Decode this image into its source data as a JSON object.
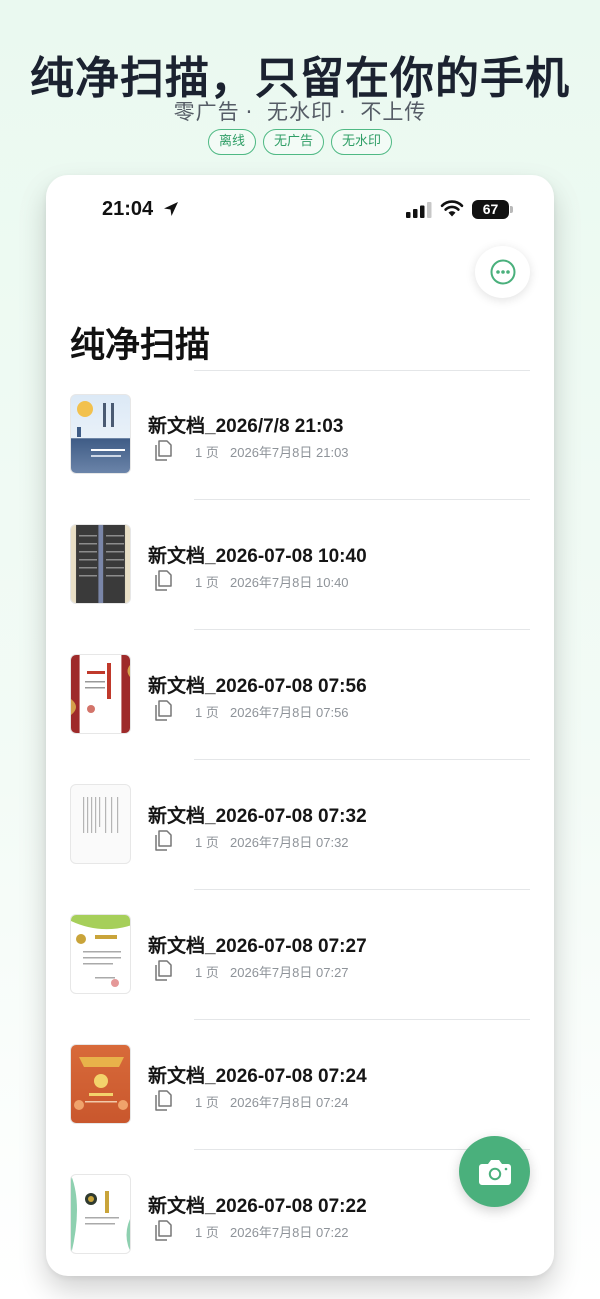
{
  "promo": {
    "title": "纯净扫描，只留在你的手机",
    "subtitle": [
      "零广告",
      "无水印",
      "不上传"
    ],
    "tags": [
      "离线",
      "无广告",
      "无水印"
    ]
  },
  "status_bar": {
    "time": "21:04",
    "battery": "67"
  },
  "header": {
    "title": "纯净扫描",
    "more_icon": "ellipsis-circle-icon"
  },
  "documents": [
    {
      "name": "新文档_2026/7/8 21:03",
      "pages": "1 页",
      "date": "2026年7月8日 21:03"
    },
    {
      "name": "新文档_2026-07-08 10:40",
      "pages": "1 页",
      "date": "2026年7月8日 10:40"
    },
    {
      "name": "新文档_2026-07-08 07:56",
      "pages": "1 页",
      "date": "2026年7月8日 07:56"
    },
    {
      "name": "新文档_2026-07-08 07:32",
      "pages": "1 页",
      "date": "2026年7月8日 07:32"
    },
    {
      "name": "新文档_2026-07-08 07:27",
      "pages": "1 页",
      "date": "2026年7月8日 07:27"
    },
    {
      "name": "新文档_2026-07-08 07:24",
      "pages": "1 页",
      "date": "2026年7月8日 07:24"
    },
    {
      "name": "新文档_2026-07-08 07:22",
      "pages": "1 页",
      "date": "2026年7月8日 07:22"
    }
  ],
  "fab": {
    "icon": "camera-icon"
  },
  "colors": {
    "accent": "#4ab07c",
    "tag_border": "#4fb984",
    "text_primary": "#151515",
    "text_secondary": "#8e9399"
  }
}
